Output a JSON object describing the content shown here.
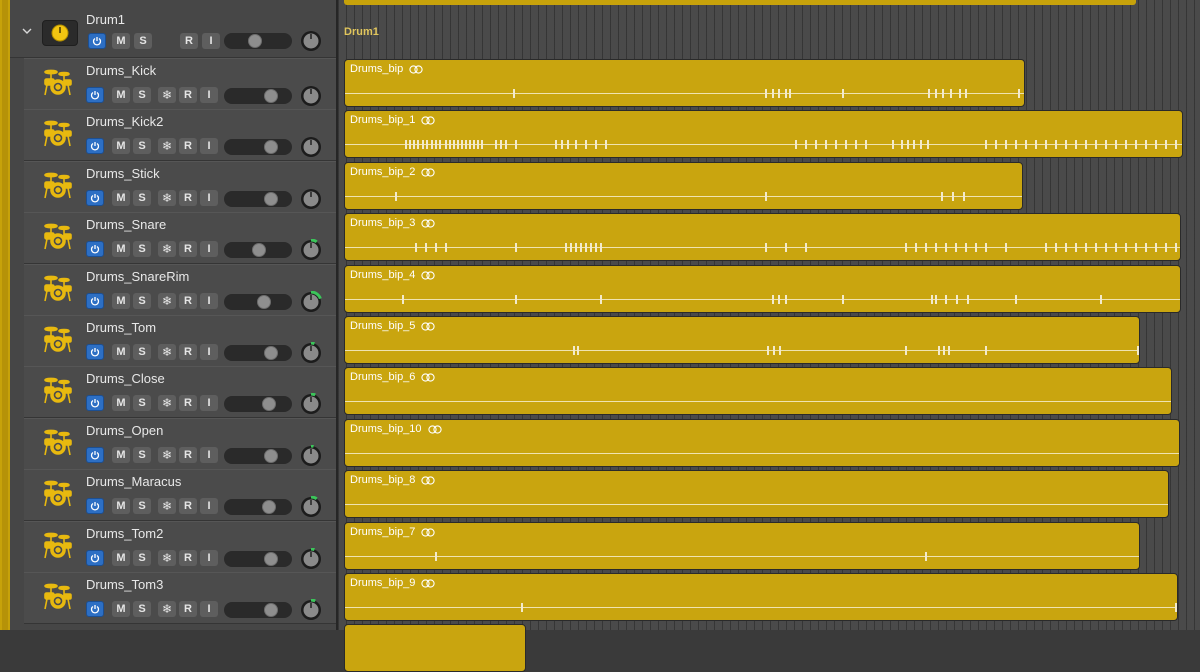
{
  "stack": {
    "name": "Drum1",
    "folder_label": "Drum1",
    "disclosure": "chevron-down-icon"
  },
  "buttons": {
    "mute": "M",
    "solo": "S",
    "record": "R",
    "input": "I",
    "freeze": "❄"
  },
  "colors": {
    "region": "#c9a50f",
    "power": "#2d6fc4",
    "icon": "#e8b90f",
    "knob_marker": "#3bc55a"
  },
  "tracks": [
    {
      "name": "Drums_Kick",
      "region": "Drums_bip"
    },
    {
      "name": "Drums_Kick2",
      "region": "Drums_bip_1"
    },
    {
      "name": "Drums_Stick",
      "region": "Drums_bip_2"
    },
    {
      "name": "Drums_Snare",
      "region": "Drums_bip_3"
    },
    {
      "name": "Drums_SnareRim",
      "region": "Drums_bip_4"
    },
    {
      "name": "Drums_Tom",
      "region": "Drums_bip_5"
    },
    {
      "name": "Drums_Close",
      "region": "Drums_bip_6"
    },
    {
      "name": "Drums_Open",
      "region": "Drums_bip_10"
    },
    {
      "name": "Drums_Maracus",
      "region": "Drums_bip_8"
    },
    {
      "name": "Drums_Tom2",
      "region": "Drums_bip_7"
    },
    {
      "name": "Drums_Tom3",
      "region": "Drums_bip_9"
    }
  ]
}
